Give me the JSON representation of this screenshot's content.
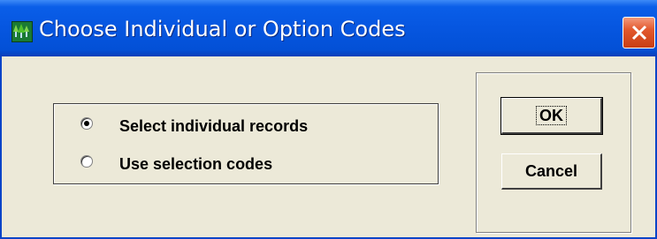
{
  "window": {
    "title": "Choose Individual or Option Codes",
    "title_bar_color": "#0655e0",
    "close_color": "#e2582d",
    "app_icon": "green-tree-app-icon",
    "close_icon": "close-x-icon"
  },
  "options": {
    "selected": "Select individual records",
    "items": [
      {
        "label": "Select individual records",
        "checked": true
      },
      {
        "label": "Use selection codes",
        "checked": false
      }
    ]
  },
  "buttons": {
    "ok_label": "OK",
    "cancel_label": "Cancel"
  }
}
